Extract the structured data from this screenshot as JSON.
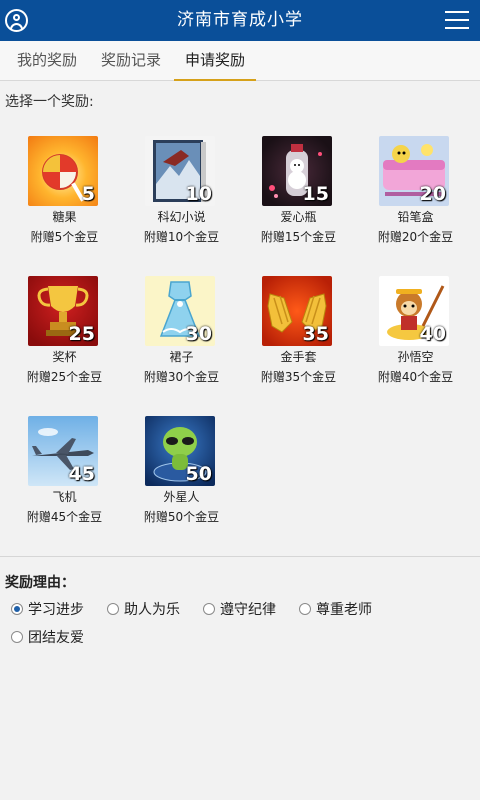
{
  "header": {
    "title": "济南市育成小学",
    "left_icon": "user-icon",
    "right_icon": "menu-icon"
  },
  "tabs": [
    {
      "label": "我的奖励",
      "active": false
    },
    {
      "label": "奖励记录",
      "active": false
    },
    {
      "label": "申请奖励",
      "active": true
    }
  ],
  "colors": {
    "header_bg": "#0a4f99",
    "active_tab_underline": "#d6a11a"
  },
  "rewards_prompt": "选择一个奖励:",
  "rewards": [
    {
      "name": "糖果",
      "points": "5",
      "bonus": "附赠5个金豆",
      "icon": "candy-icon"
    },
    {
      "name": "科幻小说",
      "points": "10",
      "bonus": "附赠10个金豆",
      "icon": "book-icon"
    },
    {
      "name": "爱心瓶",
      "points": "15",
      "bonus": "附赠15个金豆",
      "icon": "love-bottle-icon"
    },
    {
      "name": "铅笔盒",
      "points": "20",
      "bonus": "附赠20个金豆",
      "icon": "pencil-case-icon"
    },
    {
      "name": "奖杯",
      "points": "25",
      "bonus": "附赠25个金豆",
      "icon": "trophy-icon"
    },
    {
      "name": "裙子",
      "points": "30",
      "bonus": "附赠30个金豆",
      "icon": "dress-icon"
    },
    {
      "name": "金手套",
      "points": "35",
      "bonus": "附赠35个金豆",
      "icon": "gold-gloves-icon"
    },
    {
      "name": "孙悟空",
      "points": "40",
      "bonus": "附赠40个金豆",
      "icon": "monkey-king-icon"
    },
    {
      "name": "飞机",
      "points": "45",
      "bonus": "附赠45个金豆",
      "icon": "airplane-icon"
    },
    {
      "name": "外星人",
      "points": "50",
      "bonus": "附赠50个金豆",
      "icon": "alien-icon"
    }
  ],
  "reason": {
    "title": "奖励理由：",
    "options": [
      {
        "label": "学习进步",
        "checked": true
      },
      {
        "label": "助人为乐",
        "checked": false
      },
      {
        "label": "遵守纪律",
        "checked": false
      },
      {
        "label": "尊重老师",
        "checked": false
      },
      {
        "label": "团结友爱",
        "checked": false
      }
    ]
  }
}
